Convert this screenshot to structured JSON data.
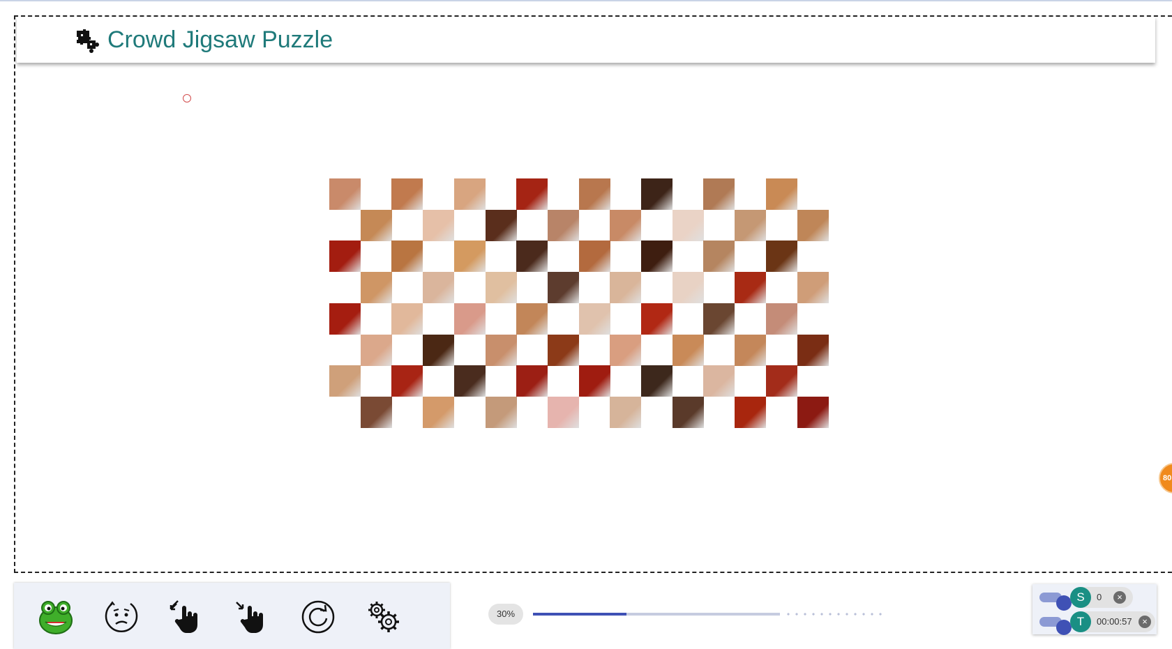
{
  "header": {
    "title": "Crowd Jigsaw Puzzle",
    "logo_icon": "puzzle-pieces-icon"
  },
  "board": {
    "piece_colors": [
      "#c98a6a",
      "#c17a4e",
      "#d8a580",
      "#a52414",
      "#b8774e",
      "#3d2418",
      "#b07a55",
      "#c98a55",
      "#c58956",
      "#e6c0a8",
      "#5a2e1c",
      "#b88468",
      "#c88a66",
      "#ead3c6",
      "#c59874",
      "#bf8658",
      "#a31d10",
      "#b97541",
      "#d49a60",
      "#4b2a1c",
      "#b36a3e",
      "#3e1e10",
      "#b58560",
      "#6b3515",
      "#cf9665",
      "#dab59c",
      "#e0bfa0",
      "#5d3c2e",
      "#d9b59a",
      "#e8d2c4",
      "#a82a14",
      "#cf9d78",
      "#a51d10",
      "#e1b89b",
      "#d99a8a",
      "#c28659",
      "#e0c2ad",
      "#b12814",
      "#6a4631",
      "#c48c78",
      "#dba88b",
      "#4b2814",
      "#c88f6c",
      "#8c3a18",
      "#d99e80",
      "#c98a58",
      "#c4875a",
      "#7a2d14",
      "#cfa07a",
      "#a82414",
      "#4a2c1e",
      "#9c1f14",
      "#9f1c10",
      "#3d281c",
      "#dbb6a0",
      "#a32c1a",
      "#7a4a34",
      "#d49a6a",
      "#c49a7a",
      "#e6b4ae",
      "#d6b49a",
      "#5a3a2a",
      "#a8260e",
      "#8c1a12"
    ]
  },
  "toolbar": {
    "tools": [
      {
        "name": "avatar-tool",
        "icon": "frog-avatar-icon"
      },
      {
        "name": "hint-tool",
        "icon": "confused-face-icon"
      },
      {
        "name": "zoom-in-tool",
        "icon": "hand-expand-icon"
      },
      {
        "name": "zoom-out-tool",
        "icon": "hand-shrink-icon"
      },
      {
        "name": "reset-tool",
        "icon": "refresh-icon"
      },
      {
        "name": "settings-tool",
        "icon": "gears-icon"
      }
    ]
  },
  "progress": {
    "label": "30%",
    "value": 0.3
  },
  "side_badge": {
    "label": "80"
  },
  "stats": {
    "score": {
      "avatar": "S",
      "value": "0"
    },
    "timer": {
      "avatar": "T",
      "value": "00:00:57"
    }
  },
  "colors": {
    "title": "#1f7a7a",
    "accent": "#3f51b5",
    "avatar": "#1a8f84",
    "badge": "#f08a1c"
  }
}
